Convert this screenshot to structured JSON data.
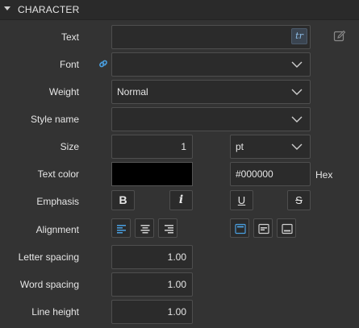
{
  "section": {
    "title": "CHARACTER"
  },
  "labels": {
    "text": "Text",
    "font": "Font",
    "weight": "Weight",
    "style_name": "Style name",
    "size": "Size",
    "text_color": "Text color",
    "emphasis": "Emphasis",
    "alignment": "Alignment",
    "letter_spacing": "Letter spacing",
    "word_spacing": "Word spacing",
    "line_height": "Line height"
  },
  "fields": {
    "text_value": "",
    "translate_label": "tr",
    "font_value": "",
    "weight_value": "Normal",
    "style_name_value": "",
    "size_value": "1",
    "size_unit": "pt",
    "color_hex": "#000000",
    "color_format": "Hex",
    "letter_spacing_value": "1.00",
    "word_spacing_value": "1.00",
    "line_height_value": "1.00"
  },
  "emphasis": {
    "bold": "B",
    "italic": "i",
    "underline": "U",
    "strikethrough": "S"
  },
  "colors": {
    "text_color": "#000000",
    "accent": "#4a9fe0",
    "panel_bg": "#333333"
  },
  "icons": [
    "chevron-down-icon",
    "edit-icon",
    "link-icon",
    "align-left-icon",
    "align-center-icon",
    "align-right-icon",
    "valign-top-icon",
    "valign-middle-icon",
    "valign-bottom-icon"
  ]
}
